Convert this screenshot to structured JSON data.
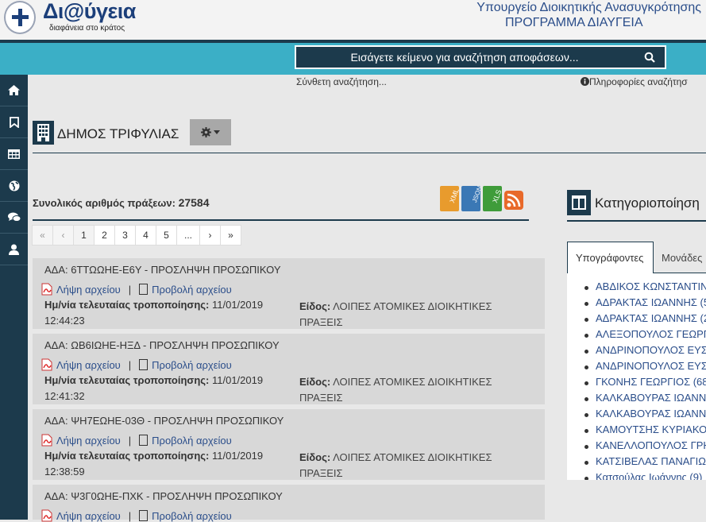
{
  "header": {
    "logo_title": "Δι@ύγεια",
    "logo_subtitle": "διαφάνεια στο κράτος",
    "ministry": "Υπουργείο Διοικητικής Ανασυγκρότησης",
    "program": "ΠΡΟΓΡΑΜΜΑ ΔΙΑΥΓΕΙΑ"
  },
  "search": {
    "placeholder": "Εισάγετε κείμενο για αναζήτηση αποφάσεων...",
    "advanced": "Σύνθετη αναζήτηση...",
    "info": "Πληροφορίες αναζήτησ"
  },
  "sidebar": {
    "items": [
      {
        "icon": "home-icon"
      },
      {
        "icon": "bookmark-icon"
      },
      {
        "icon": "table-icon"
      },
      {
        "icon": "globe-icon"
      },
      {
        "icon": "comments-icon"
      },
      {
        "icon": "user-icon"
      }
    ]
  },
  "org": {
    "name": "ΔΗΜΟΣ ΤΡΙΦΥΛΙΑΣ"
  },
  "results": {
    "total_label": "Συνολικός αριθμός πράξεων:",
    "total_value": "27584",
    "exports": [
      "XML",
      "JSON",
      "XLS",
      "RSS"
    ]
  },
  "pagination": [
    "«",
    "‹",
    "1",
    "2",
    "3",
    "4",
    "5",
    "...",
    "›",
    "»"
  ],
  "record_labels": {
    "download": "Λήψη αρχείου",
    "view": "Προβολή αρχείου",
    "separator": "|",
    "date_label": "Ημ/νία τελευταίας τροποποίησης:",
    "type_label": "Είδος:"
  },
  "records": [
    {
      "title": "ΑΔΑ: 6ΤΤΩΩΗΕ-Ε6Υ - ΠΡΟΣΛΗΨΗ ΠΡΟΣΩΠΙΚΟΥ",
      "date": "11/01/2019",
      "time": "12:44:23",
      "type": "ΛΟΙΠΕΣ ΑΤΟΜΙΚΕΣ ΔΙΟΙΚΗΤΙΚΕΣ ΠΡΑΞΕΙΣ"
    },
    {
      "title": "ΑΔΑ: ΩΒ6ΙΩΗΕ-ΗΞΔ - ΠΡΟΣΛΗΨΗ ΠΡΟΣΩΠΙΚΟΥ",
      "date": "11/01/2019",
      "time": "12:41:32",
      "type": "ΛΟΙΠΕΣ ΑΤΟΜΙΚΕΣ ΔΙΟΙΚΗΤΙΚΕΣ ΠΡΑΞΕΙΣ"
    },
    {
      "title": "ΑΔΑ: ΨΗ7ΕΩΗΕ-03Θ - ΠΡΟΣΛΗΨΗ ΠΡΟΣΩΠΙΚΟΥ",
      "date": "11/01/2019",
      "time": "12:38:59",
      "type": "ΛΟΙΠΕΣ ΑΤΟΜΙΚΕΣ ΔΙΟΙΚΗΤΙΚΕΣ ΠΡΑΞΕΙΣ"
    },
    {
      "title": "ΑΔΑ: Ψ3Γ0ΩΗΕ-ΠΧΚ - ΠΡΟΣΛΗΨΗ ΠΡΟΣΩΠΙΚΟΥ",
      "date": "",
      "time": "",
      "type": ""
    }
  ],
  "categories": {
    "title": "Κατηγοριοποίηση",
    "tabs": [
      "Υπογράφοντες",
      "Μονάδες"
    ],
    "signers": [
      "ΑΒΔΙΚΟΣ ΚΩΝΣΤΑΝΤΙΝ",
      "ΑΔΡΑΚΤΑΣ ΙΩΑΝΝΗΣ (5",
      "ΑΔΡΑΚΤΑΣ ΙΩΑΝΝΗΣ (2",
      "ΑΛΕΞΟΠΟΥΛΟΣ ΓΕΩΡΓ",
      "ΑΝΔΡΙΝΟΠΟΥΛΟΣ ΕΥΣ",
      "ΑΝΔΡΙΝΟΠΟΥΛΟΣ ΕΥΣ",
      "ΓΚΟΝΗΣ ΓΕΩΡΓΙΟΣ (68",
      "ΚΑΛΚΑΒΟΥΡΑΣ ΙΩΑΝΝ",
      "ΚΑΛΚΑΒΟΥΡΑΣ ΙΩΑΝΝ",
      "ΚΑΜΟΥΤΣΗΣ ΚΥΡΙΑΚΟ",
      "ΚΑΝΕΛΛΟΠΟΥΛΟΣ ΓΡΗ",
      "ΚΑΤΣΙΒΕΛΑΣ ΠΑΝΑΓΙΩ",
      "Κατσούλας Ιωάννης (9)"
    ]
  },
  "colors": {
    "navy": "#1c3a4c",
    "teal": "#3bafc6",
    "link": "#2a4d8a"
  }
}
